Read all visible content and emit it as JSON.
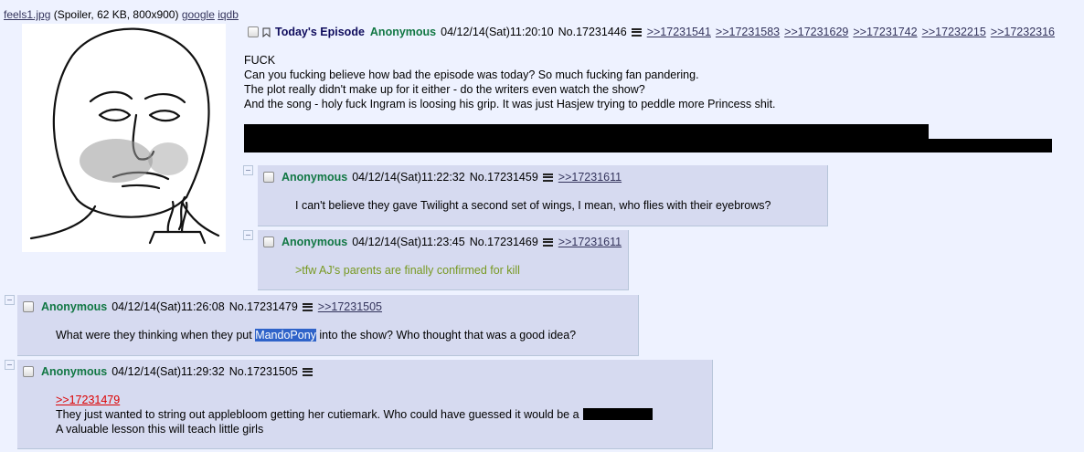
{
  "file": {
    "name": "feels1.jpg",
    "meta": "(Spoiler, 62 KB, 800x900)",
    "google": "google",
    "iqdb": "iqdb"
  },
  "op": {
    "subject": "Today's Episode",
    "name": "Anonymous",
    "datetime": "04/12/14(Sat)11:20:10",
    "number": "No.17231446",
    "backlinks": [
      ">>17231541",
      ">>17231583",
      ">>17231629",
      ">>17231742",
      ">>17232215",
      ">>17232316"
    ],
    "lines": [
      "FUCK",
      "Can you fucking believe how bad the episode was today? So much fucking fan pandering.",
      "The plot really didn't make up for it either - do the writers even watch the show?",
      "And the song - holy fuck Ingram is loosing his grip. It was just Hasjew trying to peddle more Princess shit."
    ]
  },
  "replies": [
    {
      "name": "Anonymous",
      "datetime": "04/12/14(Sat)11:22:32",
      "number": "No.17231459",
      "backlink": ">>17231611",
      "text": "I can't believe they gave Twilight a second set of wings, I mean, who flies with their eyebrows?"
    },
    {
      "name": "Anonymous",
      "datetime": "04/12/14(Sat)11:23:45",
      "number": "No.17231469",
      "backlink": ">>17231611",
      "text": ">tfw AJ's parents are finally confirmed for kill"
    },
    {
      "name": "Anonymous",
      "datetime": "04/12/14(Sat)11:26:08",
      "number": "No.17231479",
      "backlink": ">>17231505",
      "text_before": "What were they thinking when they put ",
      "highlight": "MandoPony",
      "text_after": " into the show? Who thought that was a good idea?"
    },
    {
      "name": "Anonymous",
      "datetime": "04/12/14(Sat)11:29:32",
      "number": "No.17231505",
      "quotelink": ">>17231479",
      "line1": "They just wanted to string out applebloom getting her cutiemark. Who could have guessed it would be a",
      "line2": "A valuable lesson this will teach little girls"
    }
  ],
  "colors": {
    "background": "#eef2ff",
    "reply_bg": "#d6daf0",
    "name": "#117743",
    "subject": "#0f0c5d",
    "greentext": "#789922",
    "link": "#34345c",
    "highlight": "#2f63c9"
  }
}
